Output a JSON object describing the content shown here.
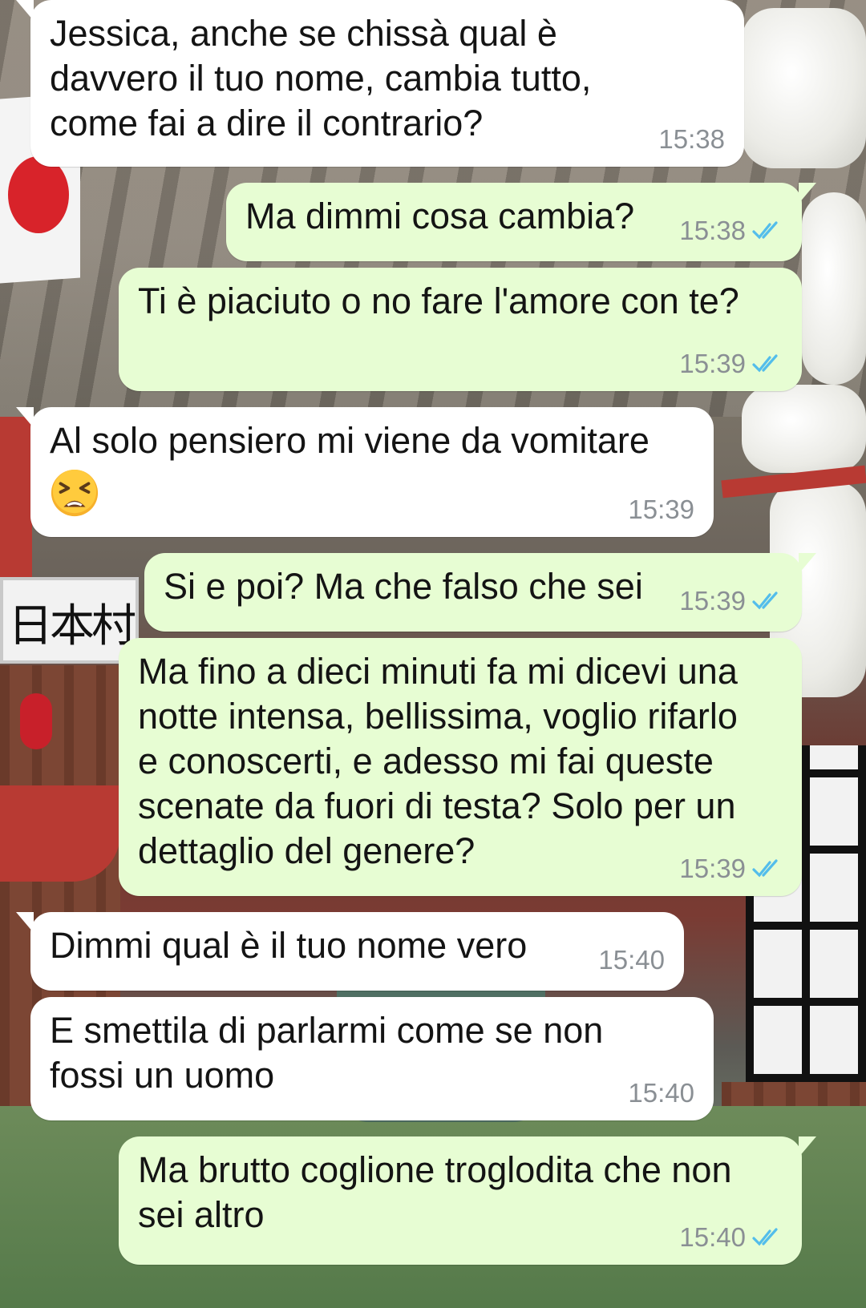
{
  "messages": [
    {
      "direction": "in",
      "text": "Jessica, anche se chissà qual è\ndavvero il tuo nome, cambia tutto,\ncome fai a dire il contrario?",
      "time": "15:38"
    },
    {
      "direction": "out",
      "text": "Ma dimmi cosa cambia?",
      "time": "15:38",
      "status": "read"
    },
    {
      "direction": "out",
      "text": "Ti è piaciuto o no fare l'amore con te?",
      "time": "15:39",
      "status": "read"
    },
    {
      "direction": "in",
      "text": "Al solo pensiero mi viene da vomitare",
      "emoji": "tired-face-emoji",
      "time": "15:39"
    },
    {
      "direction": "out",
      "text": "Si e poi? Ma che falso che sei",
      "time": "15:39",
      "status": "read"
    },
    {
      "direction": "out",
      "text": "Ma fino a dieci minuti fa mi dicevi una\nnotte intensa, bellissima, voglio rifarlo\ne conoscerti, e adesso mi fai queste\nscenate da fuori di testa? Solo per un\ndettaglio del genere?",
      "time": "15:39",
      "status": "read"
    },
    {
      "direction": "in",
      "text": "Dimmi qual è il tuo nome vero",
      "time": "15:40"
    },
    {
      "direction": "in",
      "text": "E smettila di parlarmi come se non\nfossi un uomo",
      "time": "15:40"
    },
    {
      "direction": "out",
      "text": "Ma brutto coglione troglodita che non\nsei altro",
      "time": "15:40",
      "status": "read"
    }
  ],
  "wallpaper": {
    "sign_text": "日本村"
  },
  "colors": {
    "incoming": "#ffffff",
    "outgoing": "#e7fdd3",
    "read_ticks": "#53bdeb",
    "timestamp": "#8a8f94"
  }
}
